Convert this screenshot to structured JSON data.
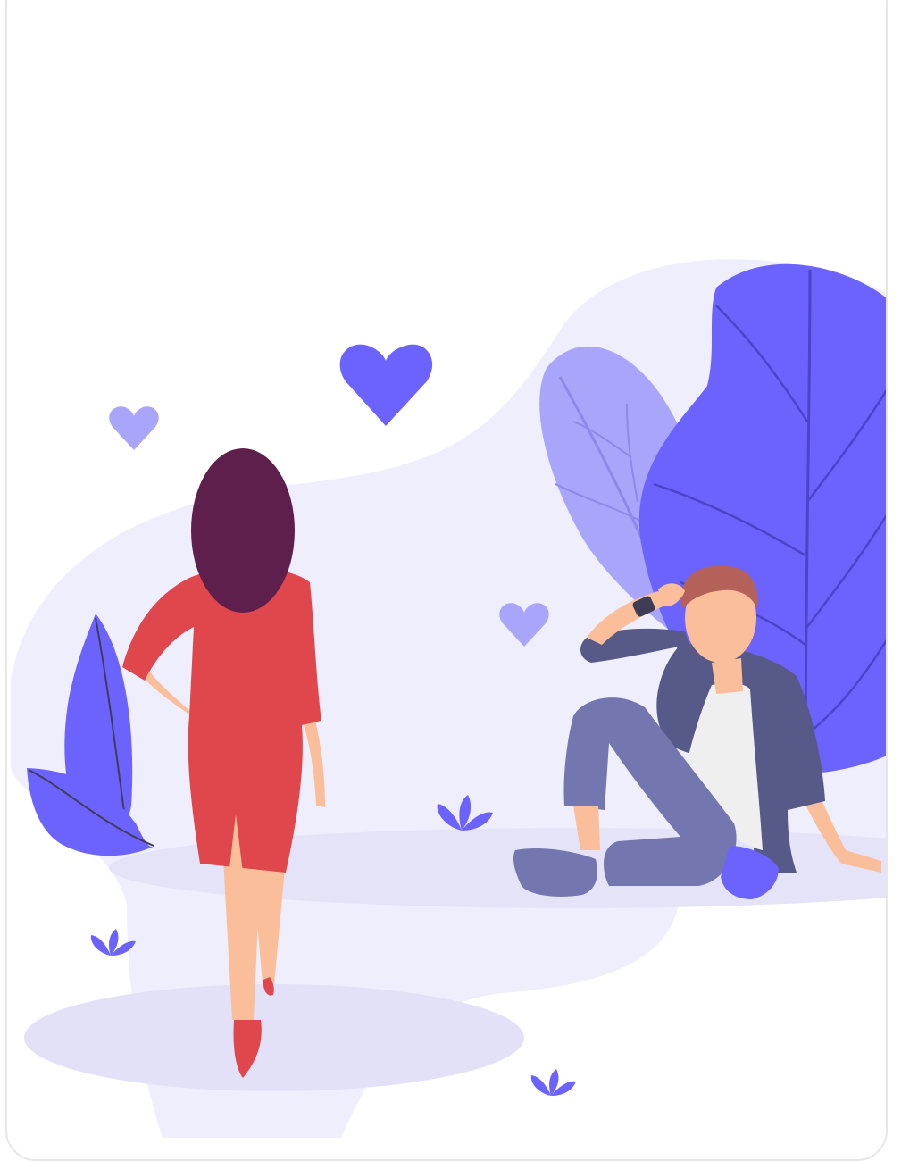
{
  "card": {
    "variant": "illustration-card"
  },
  "illustration": {
    "subject": "dating-illustration",
    "colors": {
      "background_blob": "#efeefc",
      "floor_shadow": "#e3e1f7",
      "primary": "#6c63ff",
      "primary_light": "#a9a5fb",
      "dress": "#e0474c",
      "hair_woman": "#5e1f4c",
      "skin": "#fbbe9b",
      "hair_man": "#b4615a",
      "jacket": "#575a89",
      "pants": "#7476b0",
      "shirt": "#efefef"
    },
    "icons": [
      "heart-icon",
      "heart-icon",
      "heart-icon",
      "leaf-icon",
      "sprout-icon"
    ]
  }
}
